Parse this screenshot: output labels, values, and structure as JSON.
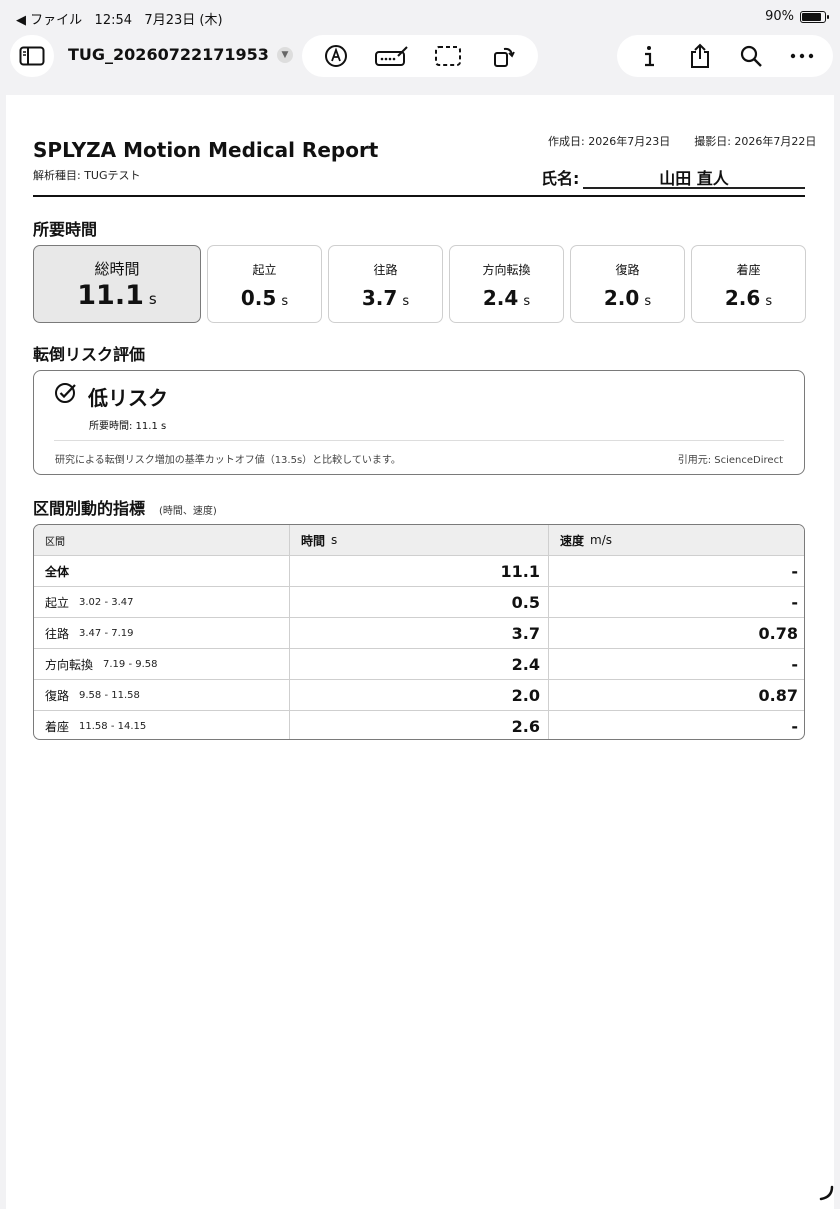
{
  "status_bar": {
    "back_label": "◀ ファイル",
    "time": "12:54",
    "date": "7月23日 (木)",
    "battery": "90%",
    "battery_level": 0.9
  },
  "toolbar": {
    "document_title": "TUG_20260722171953",
    "tool_icons": [
      "markup-pen-icon",
      "text-box-icon",
      "select-area-icon",
      "rotate-icon"
    ],
    "action_icons": [
      "info-icon",
      "share-icon",
      "search-icon",
      "more-icon"
    ]
  },
  "report": {
    "title": "SPLYZA Motion Medical Report",
    "analysis_type": "解析種目: TUGテスト",
    "created_date": "作成日: 2026年7月23日",
    "shot_date": "撮影日: 2026年7月22日",
    "name_label": "氏名:",
    "patient_name": "山田 直人",
    "duration_heading": "所要時間",
    "unit": "s",
    "metrics": [
      {
        "label": "総時間",
        "value": "11.1"
      },
      {
        "label": "起立",
        "value": "0.5"
      },
      {
        "label": "往路",
        "value": "3.7"
      },
      {
        "label": "方向転換",
        "value": "2.4"
      },
      {
        "label": "復路",
        "value": "2.0"
      },
      {
        "label": "着座",
        "value": "2.6"
      }
    ],
    "risk_heading": "転倒リスク評価",
    "risk": {
      "level": "低リスク",
      "time": "所要時間: 11.1 s",
      "note": "研究による転倒リスク増加の基準カットオフ値（13.5s）と比較しています。",
      "citation": "引用元: ScienceDirect"
    },
    "segments_heading": "区間別動的指標",
    "segments_subheading": "(時間、速度)",
    "table": {
      "col_section": "区間",
      "col_time": "時間",
      "col_time_unit": "s",
      "col_speed": "速度",
      "col_speed_unit": "m/s",
      "rows": [
        {
          "section": "全体",
          "range": "",
          "time": "11.1",
          "speed": "-"
        },
        {
          "section": "起立",
          "range": "3.02 - 3.47",
          "time": "0.5",
          "speed": "-"
        },
        {
          "section": "往路",
          "range": "3.47 - 7.19",
          "time": "3.7",
          "speed": "0.78"
        },
        {
          "section": "方向転換",
          "range": "7.19 - 9.58",
          "time": "2.4",
          "speed": "-"
        },
        {
          "section": "復路",
          "range": "9.58 - 11.58",
          "time": "2.0",
          "speed": "0.87"
        },
        {
          "section": "着座",
          "range": "11.58 - 14.15",
          "time": "2.6",
          "speed": "-"
        }
      ]
    }
  }
}
